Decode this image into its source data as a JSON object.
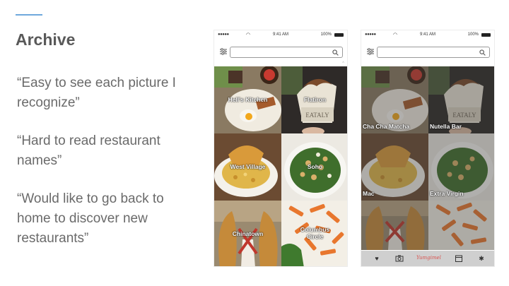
{
  "slide": {
    "title": "Archive",
    "quotes": [
      "“Easy to see each picture I recognize”",
      "“Hard to read restaurant names”",
      "“Would like to go back to home to discover new restaurants”"
    ],
    "accent_color": "#6fa8dc"
  },
  "phone_a": {
    "status": {
      "signal": "●●●●●",
      "time": "9:41 AM",
      "battery": "100%"
    },
    "tiles": [
      {
        "label": "Hell's Kitchen",
        "photo": "brunch-plate"
      },
      {
        "label": "Flatiron",
        "photo": "eataly-gelato"
      },
      {
        "label": "West Village",
        "photo": "mac-and-cheese"
      },
      {
        "label": "Soho",
        "photo": "kale-salad"
      },
      {
        "label": "Chinatown",
        "photo": "churros"
      },
      {
        "label": "Columbus Circle",
        "photo": "penne-pasta"
      }
    ]
  },
  "phone_b": {
    "status": {
      "signal": "●●●●●",
      "time": "9:41 AM",
      "battery": "100%"
    },
    "tiles": [
      {
        "label": "Cha Cha Matcha",
        "photo": "brunch-plate"
      },
      {
        "label": "Nutella Bar",
        "photo": "eataly-gelato"
      },
      {
        "label": "Mac",
        "photo": "mac-and-cheese"
      },
      {
        "label": "Extra Virgin",
        "photo": "kale-salad"
      },
      {
        "label": "",
        "photo": "churros"
      },
      {
        "label": "",
        "photo": "penne-pasta"
      }
    ],
    "tab_bar": {
      "tabs": [
        "heart-icon",
        "camera-icon",
        "app-logo",
        "calendar-icon",
        "gear-icon"
      ],
      "logo_text": "Yumgimel",
      "logo_color": "#d9534f"
    }
  }
}
